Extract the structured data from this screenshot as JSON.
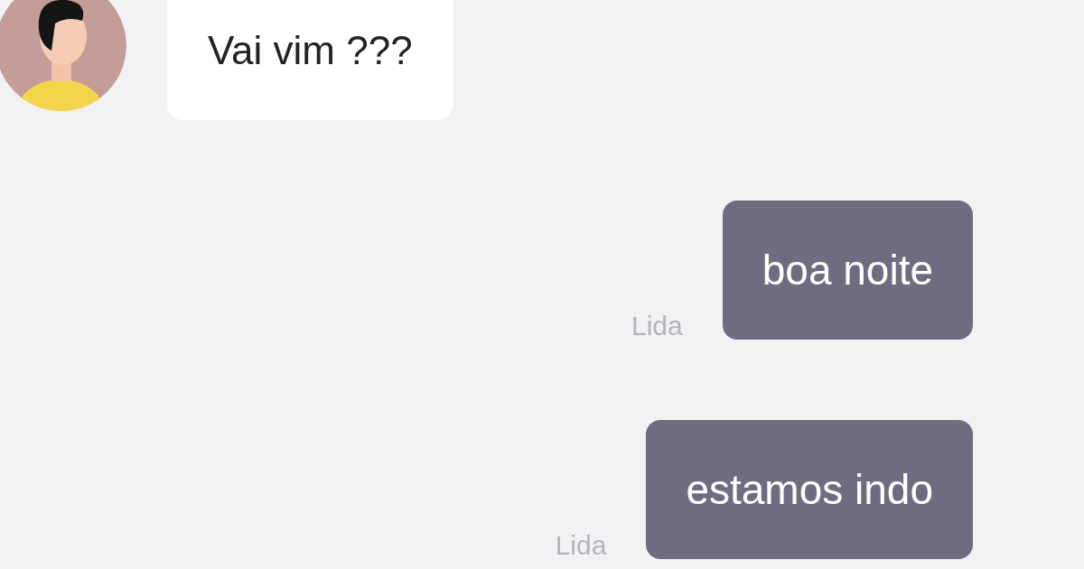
{
  "messages": [
    {
      "kind": "incoming",
      "text": "Vai vim ???"
    },
    {
      "kind": "outgoing",
      "text": "boa noite",
      "status": "Lida"
    },
    {
      "kind": "outgoing",
      "text": "estamos indo",
      "status": "Lida"
    }
  ]
}
